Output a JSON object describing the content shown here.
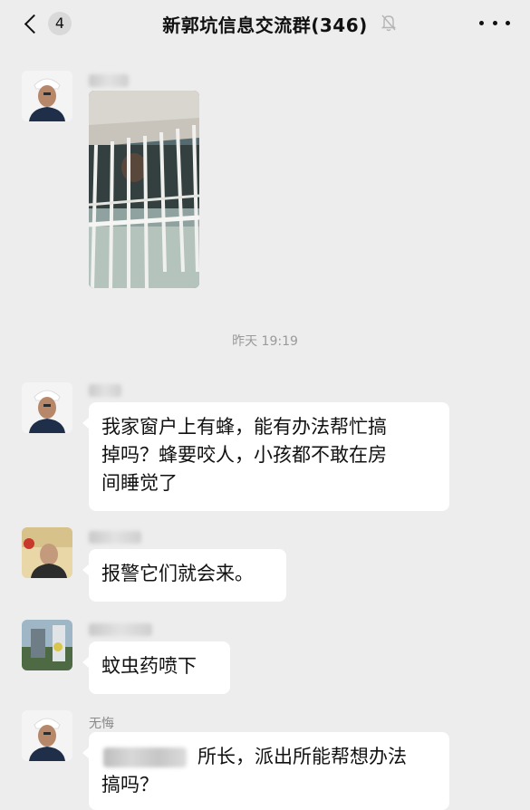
{
  "header": {
    "back_badge": "4",
    "title": "新郭坑信息交流群(346)"
  },
  "icons": {
    "back": "chevron-left-icon",
    "mute": "bell-muted-icon",
    "more": "more-dots-icon"
  },
  "timestamp": "昨天 19:19",
  "messages": [
    {
      "sender": "",
      "type": "image"
    },
    {
      "sender": "",
      "type": "text",
      "text_lines": [
        "我家窗户上有蜂，能有办法帮忙搞",
        "掉吗？蜂要咬人，小孩都不敢在房",
        "间睡觉了"
      ]
    },
    {
      "sender": "",
      "type": "text",
      "text_lines": [
        "报警它们就会来。"
      ]
    },
    {
      "sender": "",
      "type": "text",
      "text_lines": [
        "蚊虫药喷下"
      ]
    },
    {
      "sender": "无悔",
      "type": "text",
      "text_lines": [
        "所长，派出所能帮想办法",
        "搞吗？"
      ]
    }
  ]
}
